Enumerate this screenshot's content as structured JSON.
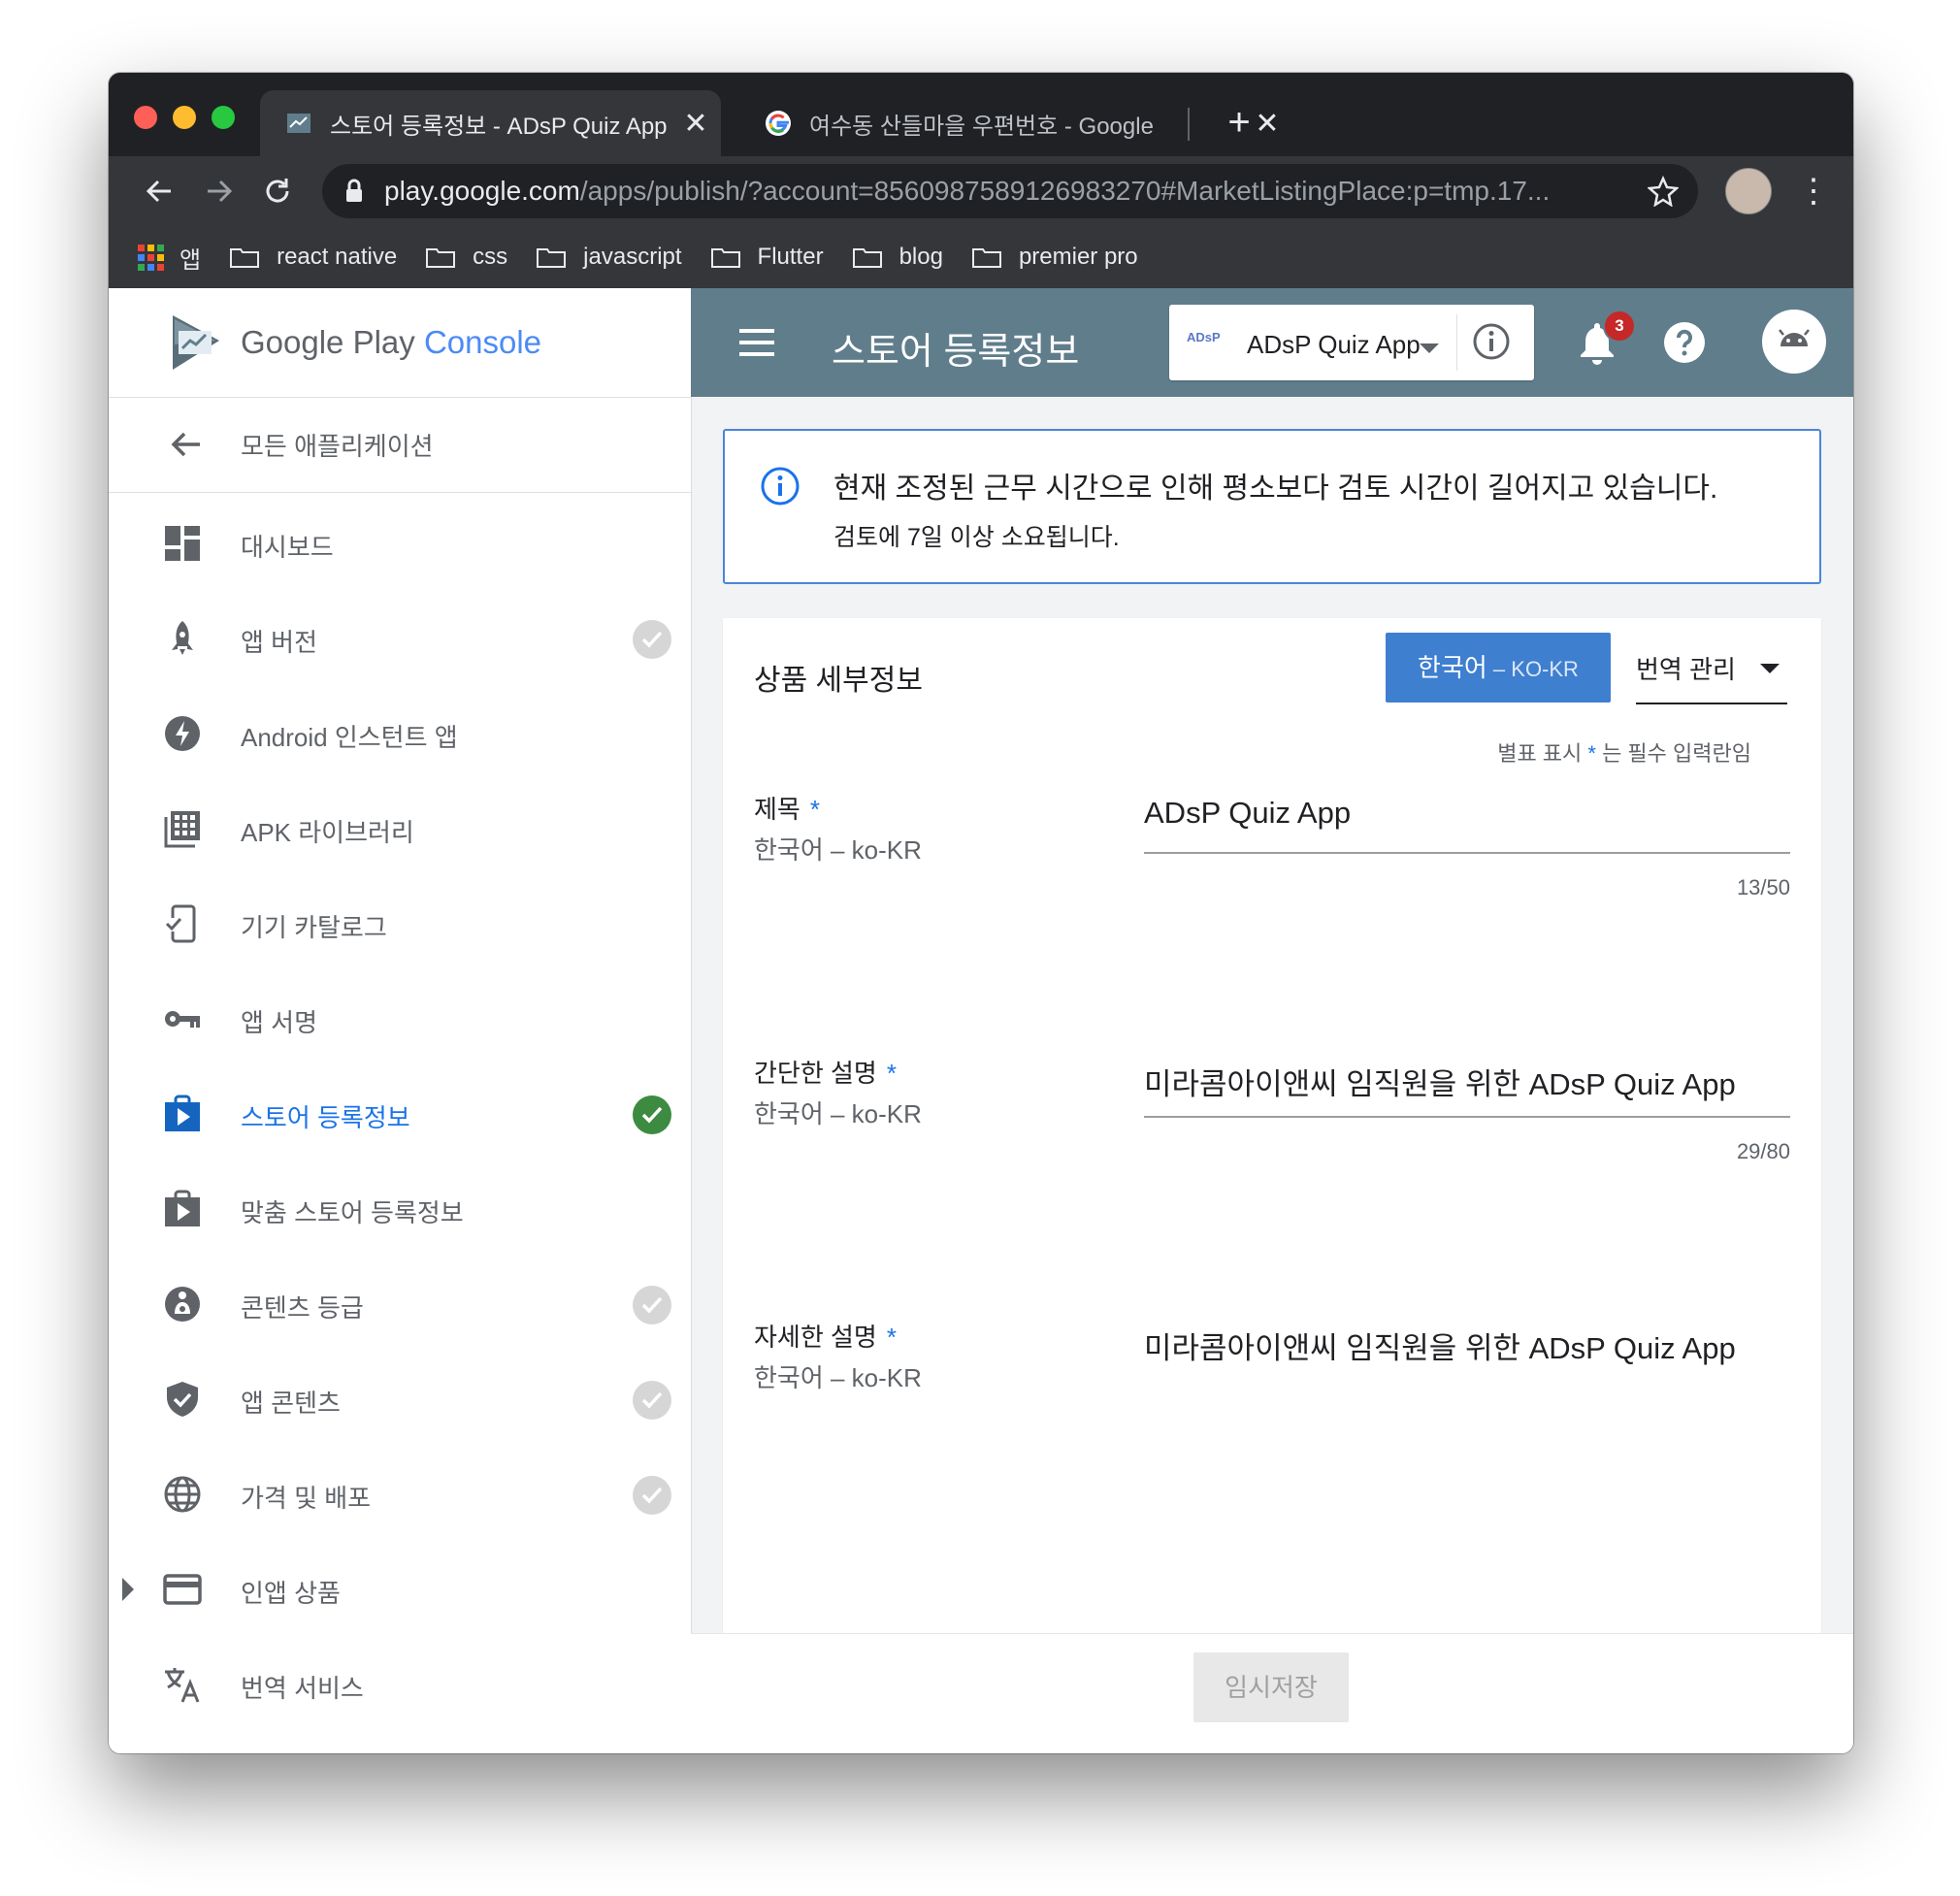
{
  "browser": {
    "tabs": [
      {
        "title": "스토어 등록정보 - ADsP Quiz App",
        "close": "✕"
      },
      {
        "title": "여수동 산들마을 우편번호 - Google",
        "close": "✕"
      }
    ],
    "new_tab": "+",
    "url_host": "play.google.com",
    "url_path": "/apps/publish/?account=8560987589126983270#MarketListingPlace:p=tmp.17...",
    "bookmarks": [
      "앱",
      "react native",
      "css",
      "javascript",
      "Flutter",
      "blog",
      "premier pro"
    ]
  },
  "brand": {
    "google_play": "Google Play",
    "console": "Console"
  },
  "sidebar": {
    "back_label": "모든 애플리케이션",
    "items": [
      {
        "label": "대시보드",
        "check": "none"
      },
      {
        "label": "앱 버전",
        "check": "grey"
      },
      {
        "label": "Android 인스턴트 앱",
        "check": "none"
      },
      {
        "label": "APK 라이브러리",
        "check": "none"
      },
      {
        "label": "기기 카탈로그",
        "check": "none"
      },
      {
        "label": "앱 서명",
        "check": "none"
      },
      {
        "label": "스토어 등록정보",
        "check": "green",
        "active": true
      },
      {
        "label": "맞춤 스토어 등록정보",
        "check": "none"
      },
      {
        "label": "콘텐츠 등급",
        "check": "grey"
      },
      {
        "label": "앱 콘텐츠",
        "check": "grey"
      },
      {
        "label": "가격 및 배포",
        "check": "grey"
      },
      {
        "label": "인앱 상품",
        "check": "none"
      },
      {
        "label": "번역 서비스",
        "check": "none"
      }
    ]
  },
  "appbar": {
    "title": "스토어 등록정보",
    "app_icon_text": "ADsP",
    "app_name": "ADsP Quiz App",
    "notification_count": "3"
  },
  "notice": {
    "heading": "현재 조정된 근무 시간으로 인해 평소보다 검토 시간이 길어지고 있습니다.",
    "subtext": "검토에 7일 이상 소요됩니다."
  },
  "details": {
    "section_title": "상품 세부정보",
    "language_button": "한국어",
    "language_code": " – KO-KR",
    "translation_menu": "번역 관리",
    "required_note_prefix": "별표 표시 ",
    "required_note_star": "*",
    "required_note_suffix": " 는 필수 입력란임",
    "fields": [
      {
        "label": "제목",
        "star": "*",
        "sublabel": "한국어 – ko-KR",
        "value": "ADsP Quiz App",
        "count": "13/50"
      },
      {
        "label": "간단한 설명",
        "star": "*",
        "sublabel": "한국어 – ko-KR",
        "value": "미라콤아이앤씨 임직원을 위한 ADsP Quiz App",
        "count": "29/80"
      },
      {
        "label": "자세한 설명",
        "star": "*",
        "sublabel": "한국어 – ko-KR",
        "value": "미라콤아이앤씨 임직원을 위한 ADsP Quiz App"
      }
    ]
  },
  "footer": {
    "save_label": "임시저장"
  }
}
